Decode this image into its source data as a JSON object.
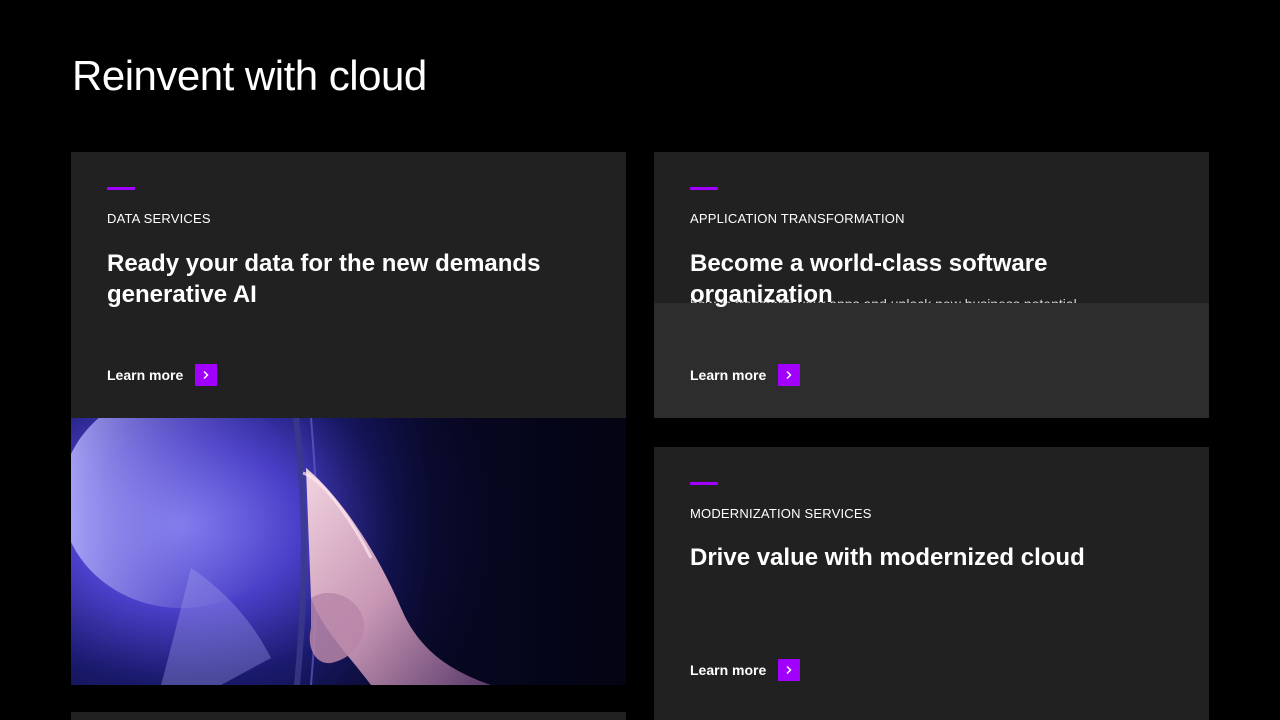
{
  "page": {
    "title": "Reinvent with cloud"
  },
  "colors": {
    "background": "#000000",
    "card": "#212121",
    "accent": "#a100ff"
  },
  "cards": [
    {
      "eyebrow": "DATA SERVICES",
      "headline": "Ready your data for the new demands generative AI",
      "link_label": "Learn more",
      "icon": "chevron-right-icon"
    },
    {
      "eyebrow": "APPLICATION TRANSFORMATION",
      "headline": "Become a world-class software organization",
      "description_peek": "how to transform your apps and unlock new business potential.",
      "link_label": "Learn more",
      "icon": "chevron-right-icon"
    },
    {
      "eyebrow": "MODERNIZATION SERVICES",
      "headline": "Drive value with modernized cloud",
      "link_label": "Learn more",
      "icon": "chevron-right-icon"
    }
  ],
  "hero_image": {
    "subject": "hand-touching-screen-image"
  }
}
